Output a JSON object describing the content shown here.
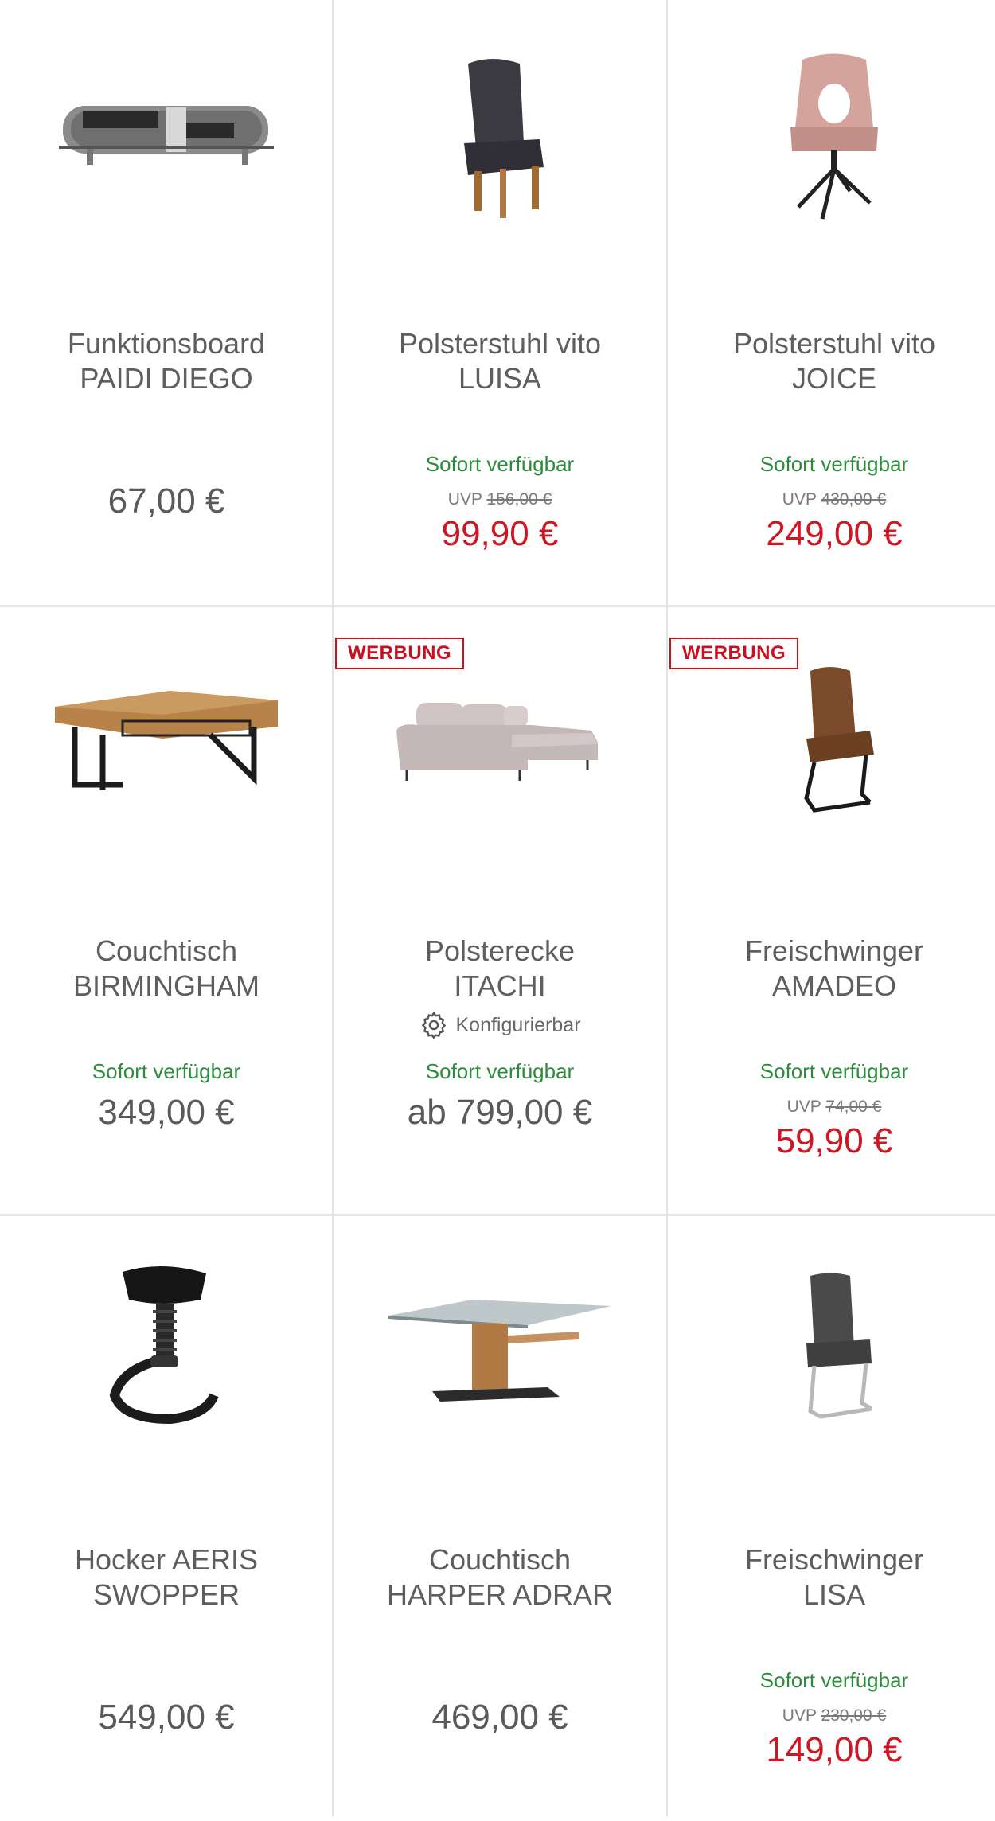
{
  "products": [
    {
      "name_line1": "Funktionsboard",
      "name_line2": "PAIDI DIEGO",
      "availability": "",
      "uvp_label": "",
      "uvp_price": "",
      "price": "67,00 €",
      "sale": false,
      "badge": "",
      "configurable": "",
      "image": "sideboard-image"
    },
    {
      "name_line1": "Polsterstuhl vito",
      "name_line2": "LUISA",
      "availability": "Sofort verfügbar",
      "uvp_label": "UVP",
      "uvp_price": "156,00 €",
      "price": "99,90 €",
      "sale": true,
      "badge": "",
      "configurable": "",
      "image": "dark-chair-image"
    },
    {
      "name_line1": "Polsterstuhl vito",
      "name_line2": "JOICE",
      "availability": "Sofort verfügbar",
      "uvp_label": "UVP",
      "uvp_price": "430,00 €",
      "price": "249,00 €",
      "sale": true,
      "badge": "",
      "configurable": "",
      "image": "pink-armchair-image"
    },
    {
      "name_line1": "Couchtisch",
      "name_line2": "BIRMINGHAM",
      "availability": "Sofort verfügbar",
      "uvp_label": "",
      "uvp_price": "",
      "price": "349,00 €",
      "sale": false,
      "badge": "",
      "configurable": "",
      "image": "wood-coffee-table-image"
    },
    {
      "name_line1": "Polsterecke",
      "name_line2": "ITACHI",
      "availability": "Sofort verfügbar",
      "uvp_label": "",
      "uvp_price": "",
      "price": "ab 799,00 €",
      "sale": false,
      "badge": "WERBUNG",
      "configurable": "Konfigurierbar",
      "image": "corner-sofa-image"
    },
    {
      "name_line1": "Freischwinger",
      "name_line2": "AMADEO",
      "availability": "Sofort verfügbar",
      "uvp_label": "UVP",
      "uvp_price": "74,00 €",
      "price": "59,90 €",
      "sale": true,
      "badge": "WERBUNG",
      "configurable": "",
      "image": "brown-cantilever-chair-image"
    },
    {
      "name_line1": "Hocker AERIS",
      "name_line2": "SWOPPER",
      "availability": "",
      "uvp_label": "",
      "uvp_price": "",
      "price": "549,00 €",
      "sale": false,
      "badge": "",
      "configurable": "",
      "image": "stool-image"
    },
    {
      "name_line1": "Couchtisch",
      "name_line2": "HARPER ADRAR",
      "availability": "",
      "uvp_label": "",
      "uvp_price": "",
      "price": "469,00 €",
      "sale": false,
      "badge": "",
      "configurable": "",
      "image": "glass-coffee-table-image"
    },
    {
      "name_line1": "Freischwinger",
      "name_line2": "LISA",
      "availability": "Sofort verfügbar",
      "uvp_label": "UVP",
      "uvp_price": "230,00 €",
      "price": "149,00 €",
      "sale": true,
      "badge": "",
      "configurable": "",
      "image": "grey-cantilever-chair-image"
    }
  ],
  "colors": {
    "sale": "#d01622",
    "available": "#2c8c3c",
    "text": "#5a5a5a",
    "badge": "#c8101e",
    "divider": "#e3e3e3"
  }
}
